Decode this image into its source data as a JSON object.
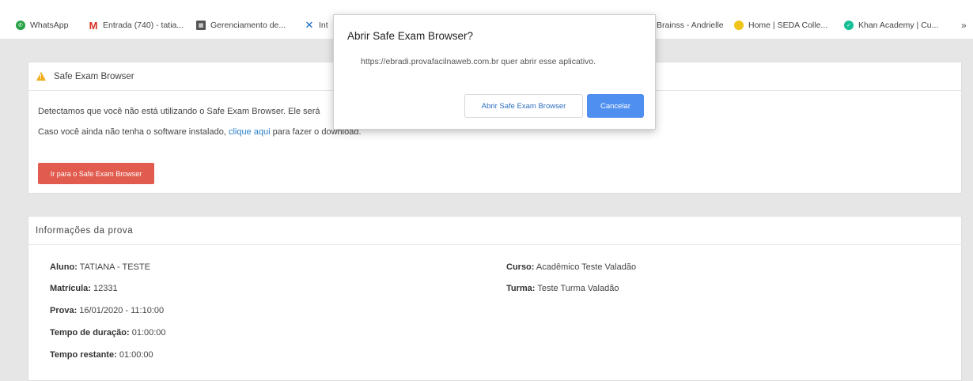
{
  "bookmarks": {
    "items": [
      {
        "label": "WhatsApp",
        "icon": "whatsapp-icon"
      },
      {
        "label": "Entrada (740) - tatia...",
        "icon": "gmail-icon"
      },
      {
        "label": "Gerenciamento de...",
        "icon": "grid-icon"
      },
      {
        "label": "Int",
        "icon": "x-logo-icon"
      },
      {
        "label": "Brainss - Andrielle",
        "icon": ""
      },
      {
        "label": "Home | SEDA Colle...",
        "icon": "home-icon"
      },
      {
        "label": "Khan Academy | Cu...",
        "icon": "khan-academy-icon"
      }
    ],
    "more": "»"
  },
  "seb_card": {
    "title": "Safe Exam Browser",
    "line1": "Detectamos que você não está utilizando o Safe Exam Browser. Ele será",
    "line2_prefix": "Caso você ainda não tenha o software instalado, ",
    "line2_link": "clique aqui",
    "line2_suffix": " para fazer o download.",
    "button": "Ir para o Safe Exam Browser"
  },
  "info_card": {
    "title": "Informações da prova",
    "left": [
      {
        "label": "Aluno:",
        "value": " TATIANA - TESTE"
      },
      {
        "label": "Matrícula:",
        "value": " 12331"
      },
      {
        "label": "Prova:",
        "value": " 16/01/2020 - 11:10:00"
      },
      {
        "label": "Tempo de duração:",
        "value": " 01:00:00"
      },
      {
        "label": "Tempo restante:",
        "value": " 01:00:00"
      }
    ],
    "right": [
      {
        "label": "Curso:",
        "value": " Acadêmico Teste Valadão"
      },
      {
        "label": "Turma:",
        "value": " Teste Turma Valadão"
      }
    ]
  },
  "dialog": {
    "title": "Abrir Safe Exam Browser?",
    "message": "https://ebradi.provafacilnaweb.com.br quer abrir esse aplicativo.",
    "open_button": "Abrir Safe Exam Browser",
    "cancel_button": "Cancelar"
  },
  "colors": {
    "warning": "#f0ad1d",
    "danger_button": "#e15b4e",
    "primary_button": "#4e8ff0",
    "link": "#2a7fc8"
  }
}
